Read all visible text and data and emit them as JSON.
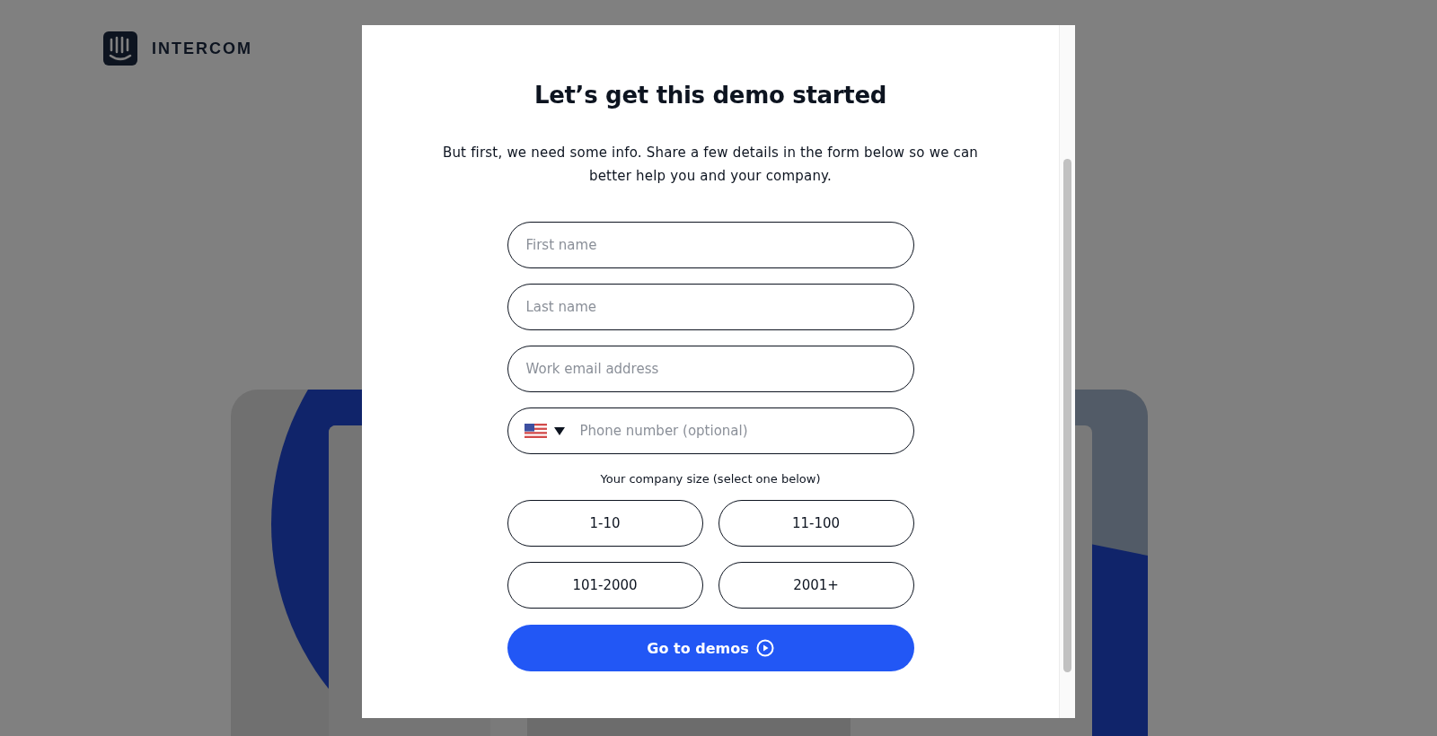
{
  "logo": {
    "text": "INTERCOM"
  },
  "modal": {
    "title": "Let’s get this demo started",
    "intro": "But first, we need some info. Share a few details in the form below so we can better help you and your company.",
    "fields": [
      {
        "kind": "text",
        "placeholder": "First name"
      },
      {
        "kind": "text",
        "placeholder": "Last name"
      },
      {
        "kind": "text",
        "placeholder": "Work email address"
      },
      {
        "kind": "phone",
        "placeholder": "Phone number (optional)"
      }
    ],
    "size_prompt": "Your company size (select one below)",
    "size_options": [
      {
        "label": "1-10",
        "selected": false
      },
      {
        "label": "11-100",
        "selected": false
      },
      {
        "label": "101-2000",
        "selected": false
      },
      {
        "label": "2001+",
        "selected": false
      }
    ],
    "submit": "Go to demos"
  }
}
